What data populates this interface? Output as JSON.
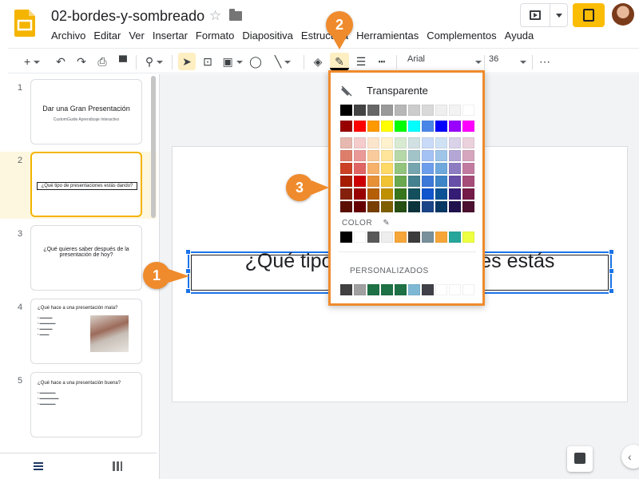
{
  "header": {
    "doc_title": "02-bordes-y-sombreado",
    "menu": [
      "Archivo",
      "Editar",
      "Ver",
      "Insertar",
      "Formato",
      "Diapositiva",
      "Estructura",
      "Herramientas",
      "Complementos",
      "Ayuda"
    ]
  },
  "toolbar": {
    "font_name": "Arial",
    "font_size": "36"
  },
  "slides": [
    {
      "num": "1",
      "title": "Dar una Gran Presentación",
      "subtitle": "CustomGuide Aprendizaje Interactivo"
    },
    {
      "num": "2",
      "title": "¿Qué tipo de presentaciones estás dando?"
    },
    {
      "num": "3",
      "title": "¿Qué quieres saber después de la presentación de hoy?"
    },
    {
      "num": "4",
      "title": "¿Qué hace a una presentación mala?"
    },
    {
      "num": "5",
      "title": "¿Qué hace a una presentación buena?"
    }
  ],
  "canvas": {
    "textbox_text": "¿Qué tipo de presentaciones estás"
  },
  "palette": {
    "transparent_label": "Transparente",
    "color_label": "COLOR",
    "custom_label": "PERSONALIZADOS",
    "top_row": [
      "#000000",
      "#434343",
      "#666666",
      "#999999",
      "#b7b7b7",
      "#cccccc",
      "#d9d9d9",
      "#efefef",
      "#f3f3f3",
      "#ffffff"
    ],
    "bright_row": [
      "#980000",
      "#ff0000",
      "#ff9900",
      "#ffff00",
      "#00ff00",
      "#00ffff",
      "#4a86e8",
      "#0000ff",
      "#9900ff",
      "#ff00ff"
    ],
    "shade_rows": [
      [
        "#e6b8af",
        "#f4cccc",
        "#fce5cd",
        "#fff2cc",
        "#d9ead3",
        "#d0e0e3",
        "#c9daf8",
        "#cfe2f3",
        "#d9d2e9",
        "#ead1dc"
      ],
      [
        "#dd7e6b",
        "#ea9999",
        "#f9cb9c",
        "#ffe599",
        "#b6d7a8",
        "#a2c4c9",
        "#a4c2f4",
        "#9fc5e8",
        "#b4a7d6",
        "#d5a6bd"
      ],
      [
        "#cc4125",
        "#e06666",
        "#f6b26b",
        "#ffd966",
        "#93c47d",
        "#76a5af",
        "#6d9eeb",
        "#6fa8dc",
        "#8e7cc3",
        "#c27ba0"
      ],
      [
        "#a61c00",
        "#cc0000",
        "#e69138",
        "#f1c232",
        "#6aa84f",
        "#45818e",
        "#3c78d8",
        "#3d85c6",
        "#674ea7",
        "#a64d79"
      ],
      [
        "#85200c",
        "#990000",
        "#b45f06",
        "#bf9000",
        "#38761d",
        "#134f5c",
        "#1155cc",
        "#0b5394",
        "#351c75",
        "#741b47"
      ],
      [
        "#5b0f00",
        "#660000",
        "#783f04",
        "#7f6000",
        "#274e13",
        "#0c343d",
        "#1c4587",
        "#073763",
        "#20124d",
        "#4c1130"
      ]
    ],
    "theme_row": [
      "#000000",
      "#ffffff",
      "#595959",
      "#eeeeee",
      "#f6a638",
      "#3c3c3c",
      "#78909c",
      "#f6a638",
      "#26a69a",
      "#eeff41"
    ],
    "custom_row": [
      "#404040",
      "#a0a0a0",
      "#1e7145",
      "#1e7145",
      "#1e7145",
      "#7fb8d4",
      "#404048",
      "#ffffff",
      "#ffffff",
      "#ffffff"
    ]
  },
  "callouts": [
    "1",
    "2",
    "3"
  ],
  "colors": {
    "accent": "#ef8b2c",
    "selection": "#1a73e8",
    "brand": "#f4b400"
  }
}
